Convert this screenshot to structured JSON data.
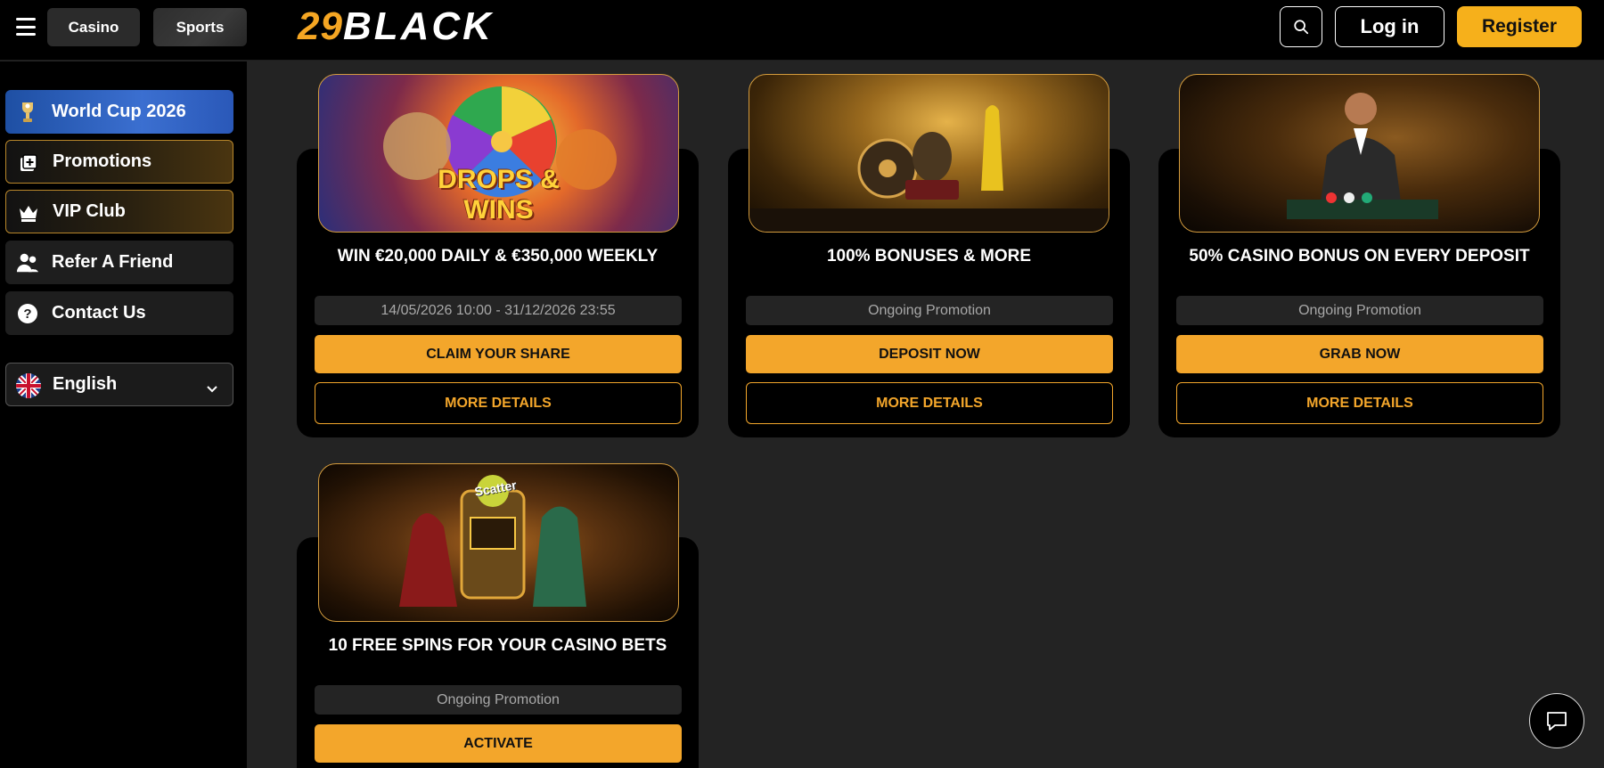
{
  "header": {
    "tabs": [
      "Casino",
      "Sports"
    ],
    "logo_num": "29",
    "logo_word": "BLACK",
    "login_label": "Log in",
    "register_label": "Register"
  },
  "sidebar": {
    "items": [
      {
        "label": "World Cup 2026",
        "icon": "trophy-icon"
      },
      {
        "label": "Promotions",
        "icon": "gift-icon"
      },
      {
        "label": "VIP Club",
        "icon": "crown-icon"
      },
      {
        "label": "Refer A Friend",
        "icon": "add-user-icon"
      },
      {
        "label": "Contact Us",
        "icon": "help-icon"
      }
    ],
    "language": "English"
  },
  "promotions": [
    {
      "title": "WIN €20,000 DAILY & €350,000 WEEKLY",
      "period": "14/05/2026 10:00 - 31/12/2026 23:55",
      "cta": "CLAIM YOUR SHARE",
      "details": "MORE DETAILS",
      "image_text": "DROPS & WINS"
    },
    {
      "title": "100% BONUSES & MORE",
      "period": "Ongoing Promotion",
      "cta": "DEPOSIT NOW",
      "details": "MORE DETAILS"
    },
    {
      "title": "50% CASINO BONUS ON EVERY DEPOSIT",
      "period": "Ongoing Promotion",
      "cta": "GRAB NOW",
      "details": "MORE DETAILS"
    },
    {
      "title": "10 FREE SPINS FOR YOUR CASINO BETS",
      "period": "Ongoing Promotion",
      "cta": "ACTIVATE",
      "image_text": "Scatter"
    }
  ],
  "colors": {
    "accent": "#f3a62b",
    "register": "#f6b01b",
    "world_cup": "#2a58b8"
  }
}
